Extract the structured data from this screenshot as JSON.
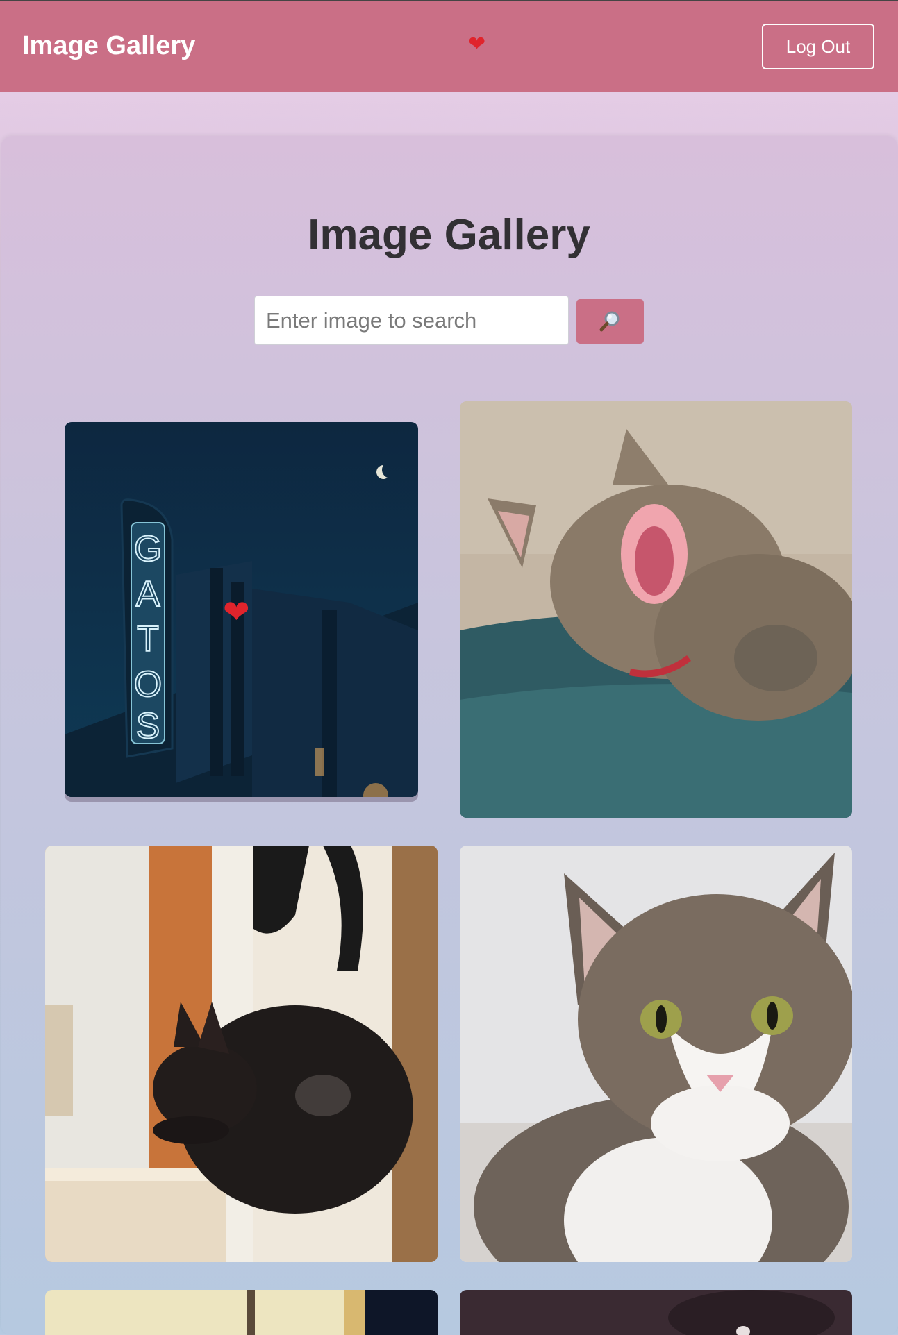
{
  "navbar": {
    "brand": "Image Gallery",
    "heart_icon": "heart-icon",
    "logout_label": "Log Out",
    "background_color": "#ca6f86"
  },
  "main": {
    "title": "Image Gallery",
    "search": {
      "placeholder": "Enter image to search",
      "value": "",
      "button_icon": "magnifier-icon"
    }
  },
  "gallery": {
    "items": [
      {
        "subject": "neon sign reading GATOS at night",
        "favorited": true
      },
      {
        "subject": "tabby cat yawning on teal blanket",
        "favorited": false
      },
      {
        "subject": "black cat grooming by window",
        "favorited": false
      },
      {
        "subject": "tabby and white cat portrait",
        "favorited": false
      },
      {
        "subject": "partially visible image",
        "favorited": false
      },
      {
        "subject": "partially visible image",
        "favorited": false
      }
    ],
    "sign_letters": [
      "G",
      "A",
      "T",
      "O",
      "S"
    ]
  },
  "colors": {
    "accent": "#ca6f86",
    "title_text": "#323034",
    "heart": "#e0242c"
  }
}
